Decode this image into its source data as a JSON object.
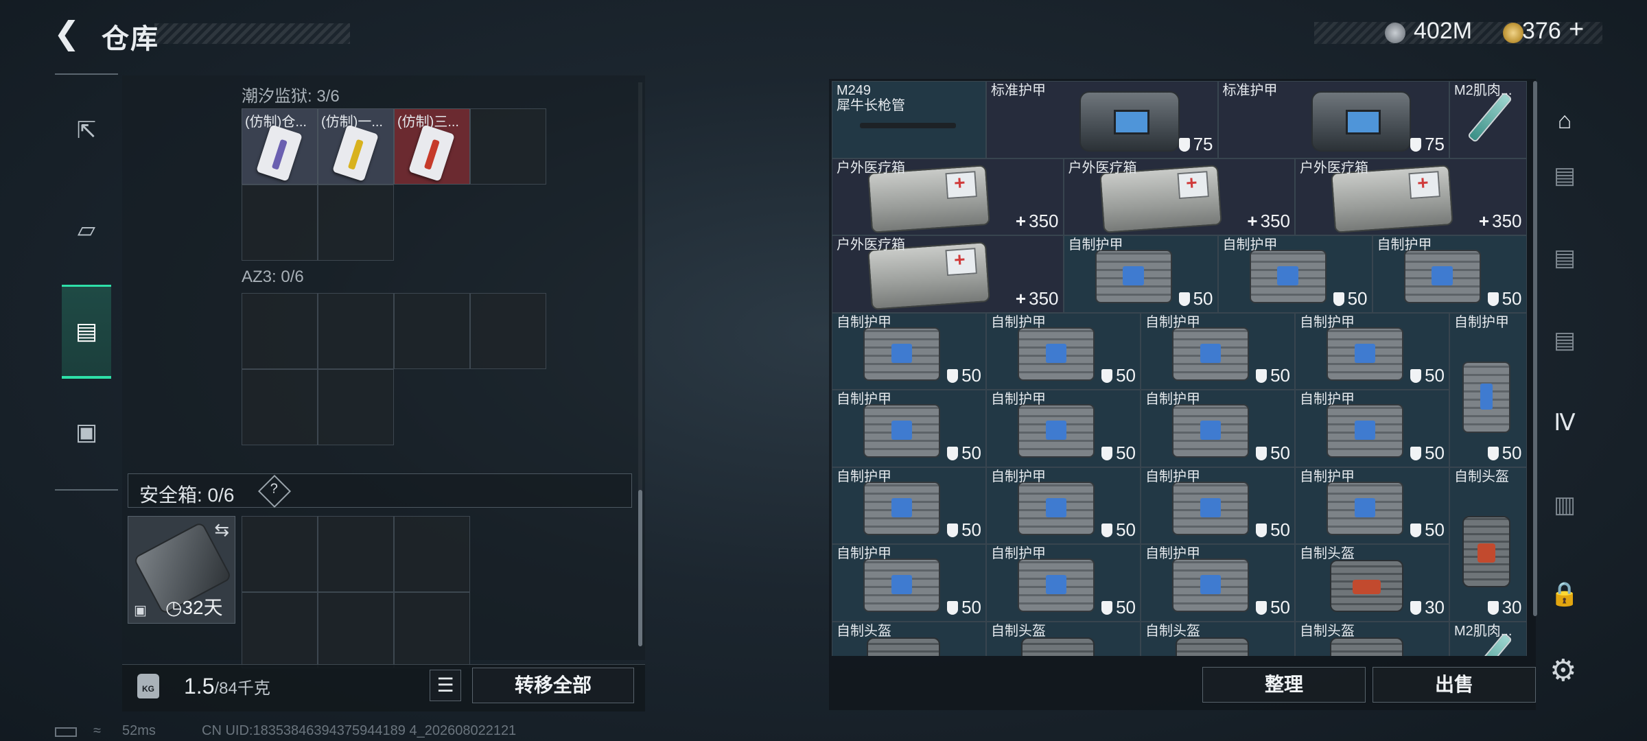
{
  "header": {
    "title": "仓库"
  },
  "currency": {
    "silver": "402M",
    "gold": "376",
    "gold_plus": "+"
  },
  "left_rail": [
    {
      "name": "weapon-tab"
    },
    {
      "name": "gear-tab"
    },
    {
      "name": "backpack-tab",
      "active": true
    },
    {
      "name": "case-tab"
    }
  ],
  "containers": {
    "tide_label": "潮汐监狱: 3/6",
    "tide_items": [
      {
        "label": "(仿制)仓...",
        "band_color": "#6a5fb0",
        "bg": "#3a4150"
      },
      {
        "label": "(仿制)一...",
        "band_color": "#d8b21e",
        "bg": "#3a4150"
      },
      {
        "label": "(仿制)三...",
        "band_color": "#c63a2a",
        "bg": "#6b2a30"
      }
    ],
    "az3_label": "AZ3: 0/6"
  },
  "safe": {
    "label": "安全箱: 0/6",
    "help": "?",
    "days": "32天"
  },
  "footer": {
    "weight_icon": "KG",
    "weight_value": "1.5",
    "weight_capacity": "/84千克",
    "transfer_all": "转移全部",
    "sort": "整理",
    "sell": "出售"
  },
  "status": {
    "ping": "52ms",
    "uid": "CN UID:18353846394375944189 4_202608022121"
  },
  "inventory_rows": [
    [
      {
        "label": "M249\n犀牛长枪管",
        "art": "gun",
        "val": "",
        "kind": "",
        "span": 1,
        "bg": "#223845"
      },
      {
        "label": "标准护甲",
        "art": "bag",
        "val": "75",
        "kind": "shield",
        "span": 1.5,
        "bg": "#262c3c"
      },
      {
        "label": "标准护甲",
        "art": "bag",
        "val": "75",
        "kind": "shield",
        "span": 1.5,
        "bg": "#262c3c"
      },
      {
        "label": "M2肌肉...",
        "art": "syringe",
        "val": "",
        "kind": "",
        "span": 0.5,
        "bg": "#262c3c"
      }
    ],
    [
      {
        "label": "户外医疗箱",
        "art": "medkit",
        "val": "350",
        "kind": "plus",
        "span": 1.5,
        "bg": "#262c3c"
      },
      {
        "label": "户外医疗箱",
        "art": "medkit",
        "val": "350",
        "kind": "plus",
        "span": 1.5,
        "bg": "#262c3c"
      },
      {
        "label": "户外医疗箱",
        "art": "medkit",
        "val": "350",
        "kind": "plus",
        "span": 1.5,
        "bg": "#262c3c"
      }
    ],
    [
      {
        "label": "户外医疗箱",
        "art": "medkit",
        "val": "350",
        "kind": "plus",
        "span": 1.5,
        "bg": "#262c3c"
      },
      {
        "label": "自制护甲",
        "art": "vest",
        "val": "50",
        "kind": "shield",
        "span": 1,
        "bg": "#223845"
      },
      {
        "label": "自制护甲",
        "art": "vest",
        "val": "50",
        "kind": "shield",
        "span": 1,
        "bg": "#223845"
      },
      {
        "label": "自制护甲",
        "art": "vest",
        "val": "50",
        "kind": "shield",
        "span": 1,
        "bg": "#223845"
      }
    ],
    [
      {
        "label": "自制护甲",
        "art": "vest",
        "val": "50",
        "kind": "shield",
        "span": 1,
        "bg": "#223845"
      },
      {
        "label": "自制护甲",
        "art": "vest",
        "val": "50",
        "kind": "shield",
        "span": 1,
        "bg": "#223845"
      },
      {
        "label": "自制护甲",
        "art": "vest",
        "val": "50",
        "kind": "shield",
        "span": 1,
        "bg": "#223845"
      },
      {
        "label": "自制护甲",
        "art": "vest",
        "val": "50",
        "kind": "shield",
        "span": 1,
        "bg": "#223845"
      },
      {
        "label": "自制护甲",
        "art": "vesttall",
        "val": "50",
        "kind": "shield",
        "span": 0.5,
        "bg": "#223845",
        "rows": 2
      }
    ],
    [
      {
        "label": "自制护甲",
        "art": "vest",
        "val": "50",
        "kind": "shield",
        "span": 1,
        "bg": "#223845"
      },
      {
        "label": "自制护甲",
        "art": "vest",
        "val": "50",
        "kind": "shield",
        "span": 1,
        "bg": "#223845"
      },
      {
        "label": "自制护甲",
        "art": "vest",
        "val": "50",
        "kind": "shield",
        "span": 1,
        "bg": "#223845"
      },
      {
        "label": "自制护甲",
        "art": "vest",
        "val": "50",
        "kind": "shield",
        "span": 1,
        "bg": "#223845"
      }
    ],
    [
      {
        "label": "自制护甲",
        "art": "vest",
        "val": "50",
        "kind": "shield",
        "span": 1,
        "bg": "#223845"
      },
      {
        "label": "自制护甲",
        "art": "vest",
        "val": "50",
        "kind": "shield",
        "span": 1,
        "bg": "#223845"
      },
      {
        "label": "自制护甲",
        "art": "vest",
        "val": "50",
        "kind": "shield",
        "span": 1,
        "bg": "#223845"
      },
      {
        "label": "自制护甲",
        "art": "vest",
        "val": "50",
        "kind": "shield",
        "span": 1,
        "bg": "#223845"
      },
      {
        "label": "自制头盔",
        "art": "helmtall",
        "val": "30",
        "kind": "shield",
        "span": 0.5,
        "bg": "#223845",
        "rows": 2
      }
    ],
    [
      {
        "label": "自制护甲",
        "art": "vest",
        "val": "50",
        "kind": "shield",
        "span": 1,
        "bg": "#223845"
      },
      {
        "label": "自制护甲",
        "art": "vest",
        "val": "50",
        "kind": "shield",
        "span": 1,
        "bg": "#223845"
      },
      {
        "label": "自制护甲",
        "art": "vest",
        "val": "50",
        "kind": "shield",
        "span": 1,
        "bg": "#223845"
      },
      {
        "label": "自制头盔",
        "art": "helm",
        "val": "30",
        "kind": "shield",
        "span": 1,
        "bg": "#223845"
      }
    ],
    [
      {
        "label": "自制头盔",
        "art": "helm",
        "val": "",
        "kind": "",
        "span": 1,
        "bg": "#223845"
      },
      {
        "label": "自制头盔",
        "art": "helm",
        "val": "",
        "kind": "",
        "span": 1,
        "bg": "#223845"
      },
      {
        "label": "自制头盔",
        "art": "helm",
        "val": "",
        "kind": "",
        "span": 1,
        "bg": "#223845"
      },
      {
        "label": "自制头盔",
        "art": "helm",
        "val": "",
        "kind": "",
        "span": 1,
        "bg": "#223845"
      },
      {
        "label": "M2肌肉...",
        "art": "syringe",
        "val": "",
        "kind": "",
        "span": 0.5,
        "bg": "#223845"
      }
    ]
  ],
  "right_rail": [
    {
      "name": "dome-icon",
      "glyph": "⌂"
    },
    {
      "name": "storage-1-icon",
      "glyph": "▤"
    },
    {
      "name": "storage-2-icon",
      "glyph": "▤"
    },
    {
      "name": "storage-3-icon",
      "glyph": "▤"
    },
    {
      "name": "storage-4-icon",
      "glyph": "Ⅳ"
    },
    {
      "name": "storage-5-icon",
      "glyph": "▥"
    },
    {
      "name": "lock-icon",
      "glyph": "🔒"
    }
  ]
}
